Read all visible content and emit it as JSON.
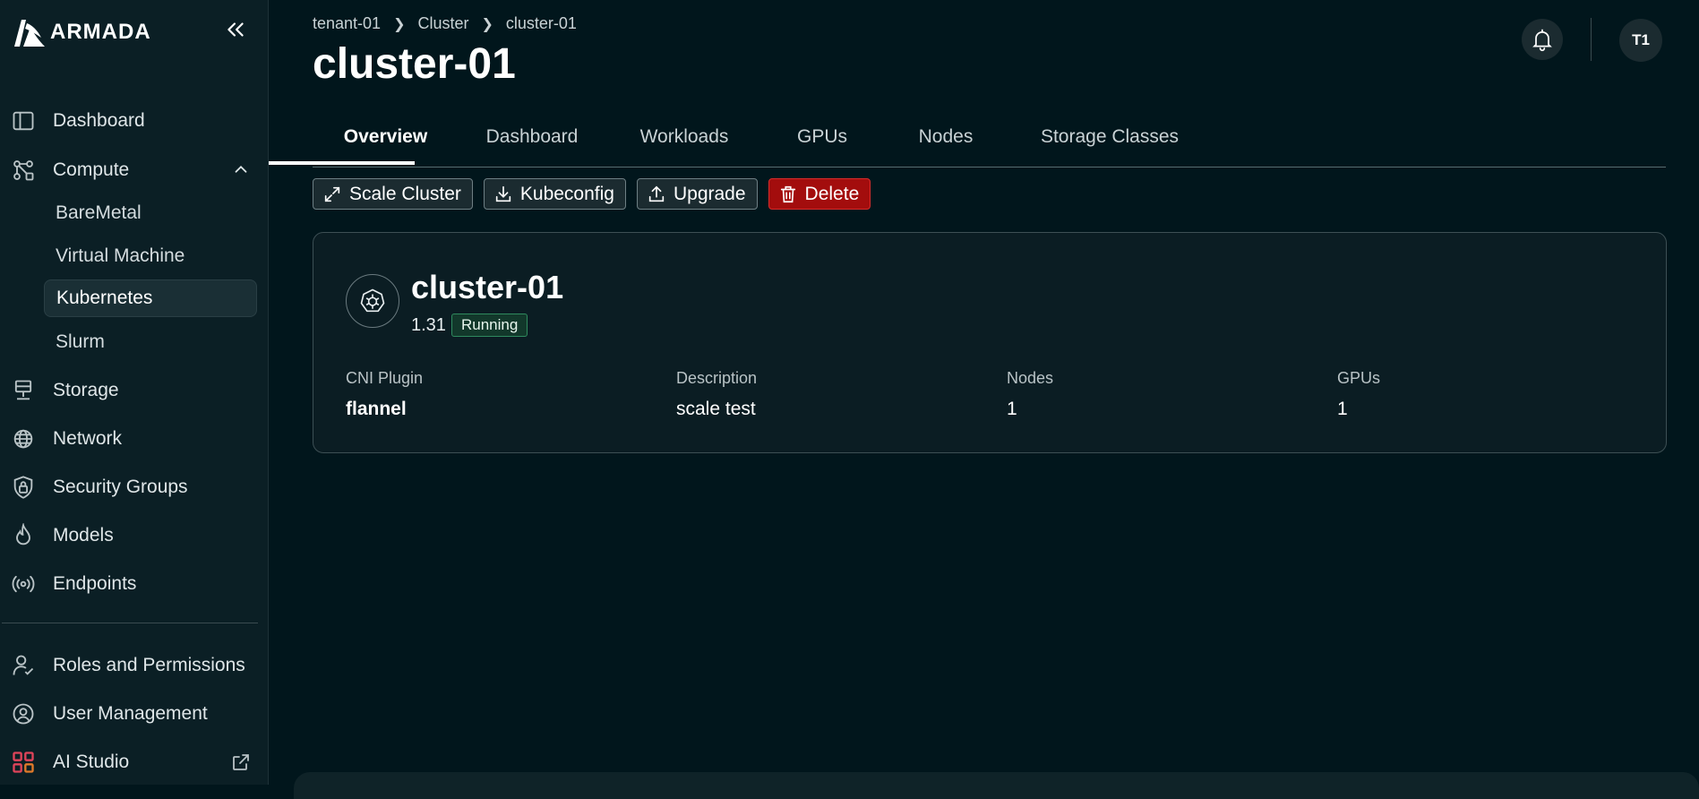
{
  "brand": {
    "name": "ARMADA"
  },
  "sidebar": {
    "items": [
      {
        "label": "Dashboard",
        "icon": "sidebar-panel-icon"
      },
      {
        "label": "Compute",
        "icon": "compute-nodes-icon",
        "expanded": true
      },
      {
        "label": "Storage",
        "icon": "storage-server-icon"
      },
      {
        "label": "Network",
        "icon": "globe-icon"
      },
      {
        "label": "Security Groups",
        "icon": "shield-lock-icon"
      },
      {
        "label": "Models",
        "icon": "flame-icon"
      },
      {
        "label": "Endpoints",
        "icon": "broadcast-icon"
      }
    ],
    "compute_sub": [
      {
        "label": "BareMetal"
      },
      {
        "label": "Virtual Machine"
      },
      {
        "label": "Kubernetes",
        "active": true
      },
      {
        "label": "Slurm"
      }
    ],
    "bottom_items": [
      {
        "label": "Roles and Permissions",
        "icon": "user-roles-icon"
      },
      {
        "label": "User Management",
        "icon": "user-gear-icon"
      },
      {
        "label": "AI Studio",
        "icon": "apps-grid-icon"
      }
    ]
  },
  "breadcrumb": [
    "tenant-01",
    "Cluster",
    "cluster-01"
  ],
  "page": {
    "title": "cluster-01"
  },
  "header": {
    "avatar_initials": "T1"
  },
  "tabs": [
    {
      "label": "Overview",
      "active": true
    },
    {
      "label": "Dashboard"
    },
    {
      "label": "Workloads"
    },
    {
      "label": "GPUs"
    },
    {
      "label": "Nodes"
    },
    {
      "label": "Storage Classes"
    }
  ],
  "toolbar": {
    "scale_label": "Scale Cluster",
    "kubeconfig_label": "Kubeconfig",
    "upgrade_label": "Upgrade",
    "delete_label": "Delete"
  },
  "cluster": {
    "name": "cluster-01",
    "version": "1.31",
    "status": "Running",
    "fields": [
      {
        "label": "CNI Plugin",
        "value": "flannel"
      },
      {
        "label": "Description",
        "value": "scale test"
      },
      {
        "label": "Nodes",
        "value": "1"
      },
      {
        "label": "GPUs",
        "value": "1"
      }
    ]
  },
  "colors": {
    "background": "#01161c",
    "sidebar": "#0b1f25",
    "danger": "#a30d0d",
    "status_green": "#2f8a5e"
  }
}
